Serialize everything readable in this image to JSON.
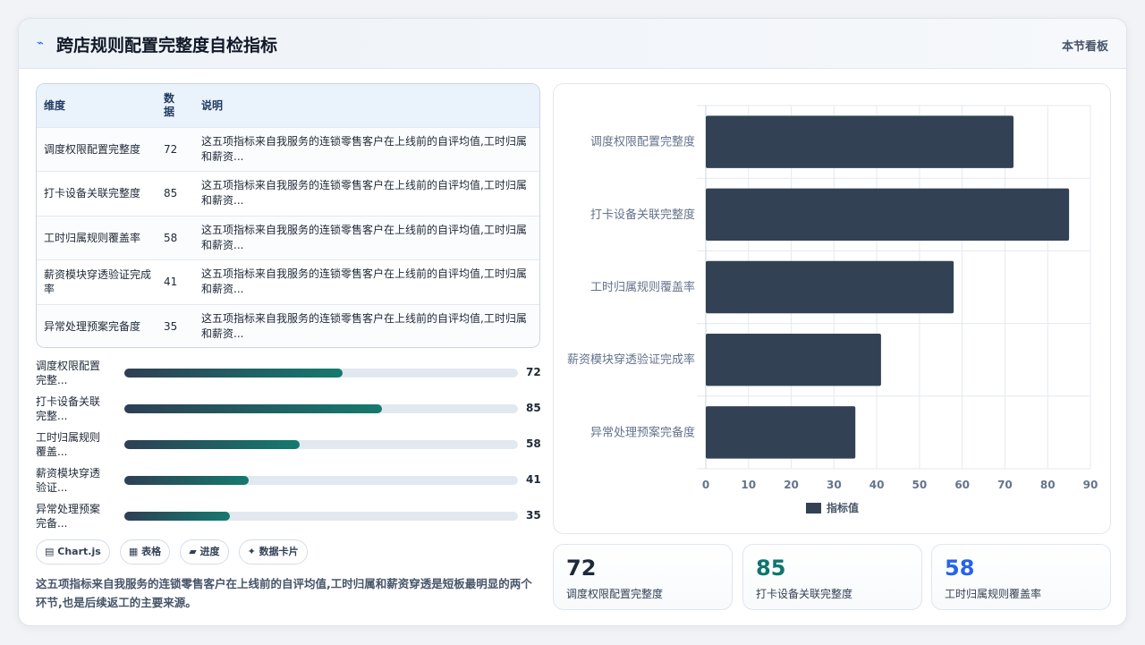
{
  "header": {
    "logo_icon": "trend-icon",
    "title": "跨店规则配置完整度自检指标",
    "section_link": "本节看板"
  },
  "table": {
    "headers": [
      "维度",
      "数据",
      "说明"
    ],
    "header_num_line1": "数",
    "header_num_line2": "据",
    "rows": [
      {
        "dim": "调度权限配置完整度",
        "value": "72",
        "desc": "这五项指标来自我服务的连锁零售客户在上线前的自评均值,工时归属和薪资..."
      },
      {
        "dim": "打卡设备关联完整度",
        "value": "85",
        "desc": "这五项指标来自我服务的连锁零售客户在上线前的自评均值,工时归属和薪资..."
      },
      {
        "dim": "工时归属规则覆盖率",
        "value": "58",
        "desc": "这五项指标来自我服务的连锁零售客户在上线前的自评均值,工时归属和薪资..."
      },
      {
        "dim": "薪资模块穿透验证完成率",
        "value": "41",
        "desc": "这五项指标来自我服务的连锁零售客户在上线前的自评均值,工时归属和薪资..."
      },
      {
        "dim": "异常处理预案完备度",
        "value": "35",
        "desc": "这五项指标来自我服务的连锁零售客户在上线前的自评均值,工时归属和薪资..."
      }
    ]
  },
  "progress": [
    {
      "label": "调度权限配置完整...",
      "value": 72,
      "display": "72"
    },
    {
      "label": "打卡设备关联完整...",
      "value": 85,
      "display": "85"
    },
    {
      "label": "工时归属规则覆盖...",
      "value": 58,
      "display": "58"
    },
    {
      "label": "薪资模块穿透验证...",
      "value": 41,
      "display": "41"
    },
    {
      "label": "异常处理预案完备...",
      "value": 35,
      "display": "35"
    }
  ],
  "progress_max": 130,
  "tags": [
    {
      "icon": "chart-icon",
      "glyph": "▤",
      "label": "Chart.js"
    },
    {
      "icon": "table-icon",
      "glyph": "▦",
      "label": "表格"
    },
    {
      "icon": "progress-icon",
      "glyph": "▰",
      "label": "进度"
    },
    {
      "icon": "sparkle-icon",
      "glyph": "✦",
      "label": "数据卡片"
    }
  ],
  "note": "这五项指标来自我服务的连锁零售客户在上线前的自评均值,工时归属和薪资穿透是短板最明显的两个环节,也是后续返工的主要来源。",
  "chart_data": {
    "type": "bar",
    "orientation": "horizontal",
    "categories": [
      "调度权限配置完整度",
      "打卡设备关联完整度",
      "工时归属规则覆盖率",
      "薪资模块穿透验证完成率",
      "异常处理预案完备度"
    ],
    "series": [
      {
        "name": "指标值",
        "values": [
          72,
          85,
          58,
          41,
          35
        ],
        "color": "#334155"
      }
    ],
    "xlim": [
      0,
      90
    ],
    "xticks": [
      "0",
      "10",
      "20",
      "30",
      "40",
      "50",
      "60",
      "70",
      "80",
      "90"
    ],
    "grid": true,
    "legend": "bottom"
  },
  "stats": [
    {
      "value": "72",
      "label": "调度权限配置完整度",
      "color": "#1e293b"
    },
    {
      "value": "85",
      "label": "打卡设备关联完整度",
      "color": "#0f766e"
    },
    {
      "value": "58",
      "label": "工时归属规则覆盖率",
      "color": "#2563eb"
    }
  ]
}
